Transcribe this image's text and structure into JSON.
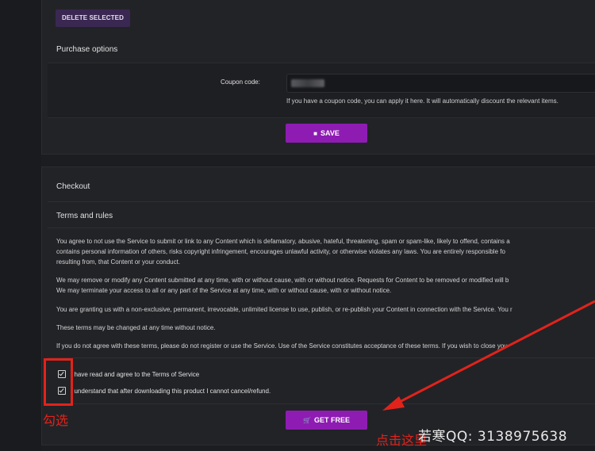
{
  "purchase": {
    "delete_label": "DELETE SELECTED",
    "title": "Purchase options",
    "coupon_label": "Coupon code:",
    "coupon_value": "",
    "coupon_help": "If you have a coupon code, you can apply it here. It will automatically discount the relevant items.",
    "save_icon": "floppy-disk-icon",
    "save_label": "SAVE"
  },
  "checkout": {
    "title": "Checkout",
    "terms_title": "Terms and rules",
    "paragraphs": [
      "You agree to not use the Service to submit or link to any Content which is defamatory, abusive, hateful, threatening, spam or spam-like, likely to offend, contains a",
      "contains personal information of others, risks copyright infringement, encourages unlawful activity, or otherwise violates any laws. You are entirely responsible fo",
      "resulting from, that Content or your conduct.",
      "We may remove or modify any Content submitted at any time, with or without cause, with or without notice. Requests for Content to be removed or modified will b",
      "We may terminate your access to all or any part of the Service at any time, with or without cause, with or without notice.",
      "You are granting us with a non-exclusive, permanent, irrevocable, unlimited license to use, publish, or re-publish your Content in connection with the Service. You r",
      "These terms may be changed at any time without notice.",
      "If you do not agree with these terms, please do not register or use the Service. Use of the Service constitutes acceptance of these terms. If you wish to close you"
    ],
    "check_agree": "I have read and agree to the Terms of Service",
    "check_refund": "I understand that after downloading this product I cannot cancel/refund.",
    "get_icon": "cart-icon",
    "get_label": "GET FREE"
  },
  "annotations": {
    "check_hint": "勾选",
    "click_hint": "点击这里",
    "watermark": "若寒QQ: 3138975638",
    "color": "#e1231b"
  }
}
